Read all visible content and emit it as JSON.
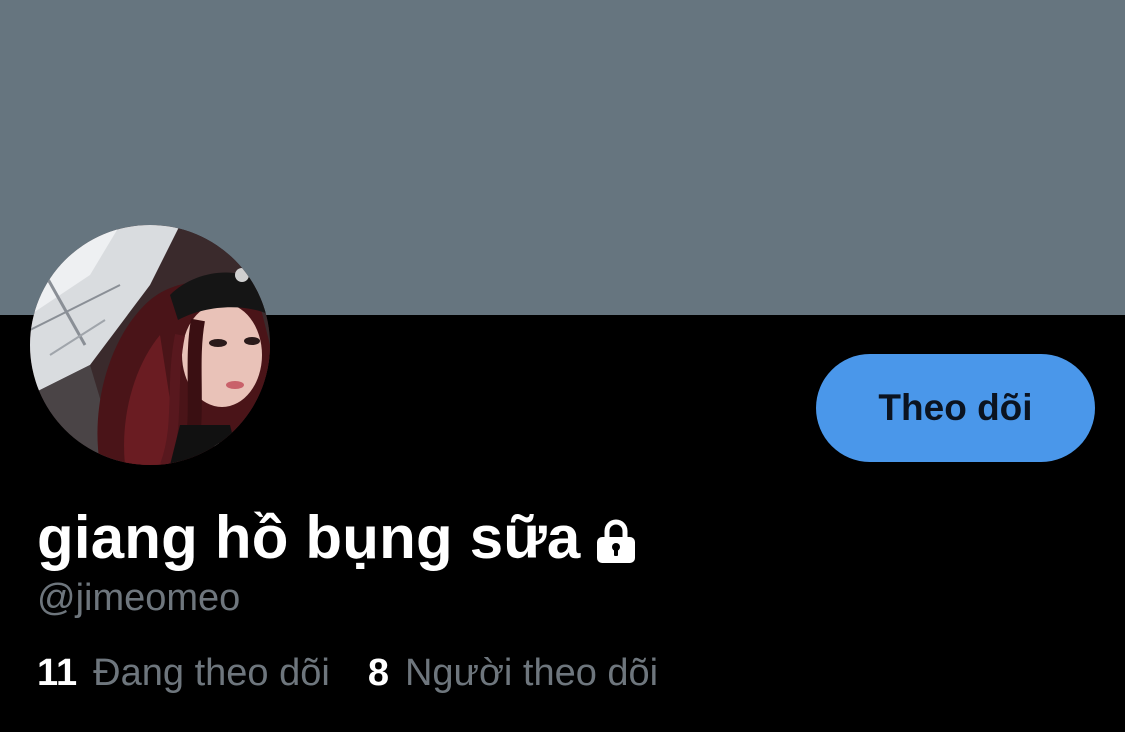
{
  "profile": {
    "display_name": "giang hồ bụng sữa",
    "handle": "@jimeomeo",
    "protected_icon": "lock-icon",
    "avatar_icon": "avatar"
  },
  "actions": {
    "follow_label": "Theo dõi"
  },
  "stats": {
    "following_count": "11",
    "following_label": "Đang theo dõi",
    "followers_count": "8",
    "followers_label": "Người theo dõi"
  },
  "colors": {
    "banner": "#66757f",
    "background": "#000000",
    "accent": "#4a97ea",
    "secondary_text": "#6e767d",
    "primary_text": "#ffffff"
  }
}
